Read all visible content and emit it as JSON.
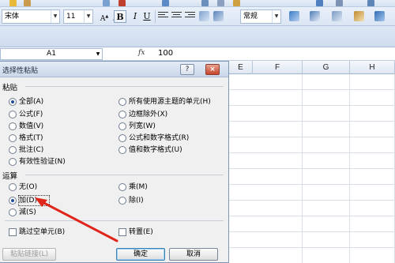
{
  "ribbon": {
    "font_name": "宋体",
    "font_size": "11",
    "bold": "B",
    "italic": "I",
    "underline": "U",
    "number_format": "常规",
    "accent_color": "#cbd8ea"
  },
  "formula_bar": {
    "name_box": "A1",
    "fx": "fx",
    "value": "100"
  },
  "columns": [
    "E",
    "F",
    "G",
    "H"
  ],
  "dialog": {
    "title": "选择性粘贴",
    "help": "?",
    "close": "×",
    "paste_label": "粘贴",
    "paste_left": [
      {
        "label": "全部(A)",
        "selected": true
      },
      {
        "label": "公式(F)",
        "selected": false
      },
      {
        "label": "数值(V)",
        "selected": false
      },
      {
        "label": "格式(T)",
        "selected": false
      },
      {
        "label": "批注(C)",
        "selected": false
      },
      {
        "label": "有效性验证(N)",
        "selected": false
      }
    ],
    "paste_right": [
      {
        "label": "所有使用源主题的单元(H)",
        "selected": false
      },
      {
        "label": "边框除外(X)",
        "selected": false
      },
      {
        "label": "列宽(W)",
        "selected": false
      },
      {
        "label": "公式和数字格式(R)",
        "selected": false
      },
      {
        "label": "值和数字格式(U)",
        "selected": false
      }
    ],
    "operation_label": "运算",
    "op_left": [
      {
        "label": "无(O)",
        "selected": false
      },
      {
        "label": "加(D)",
        "selected": true
      },
      {
        "label": "減(S)",
        "selected": false
      }
    ],
    "op_right": [
      {
        "label": "乘(M)",
        "selected": false
      },
      {
        "label": "除(I)",
        "selected": false
      }
    ],
    "skip_blanks": "跳过空单元(B)",
    "transpose": "转置(E)",
    "paste_link": "粘贴链接(L)",
    "ok": "确定",
    "cancel": "取消"
  },
  "annotation": {
    "arrow_color": "#e0251b"
  }
}
